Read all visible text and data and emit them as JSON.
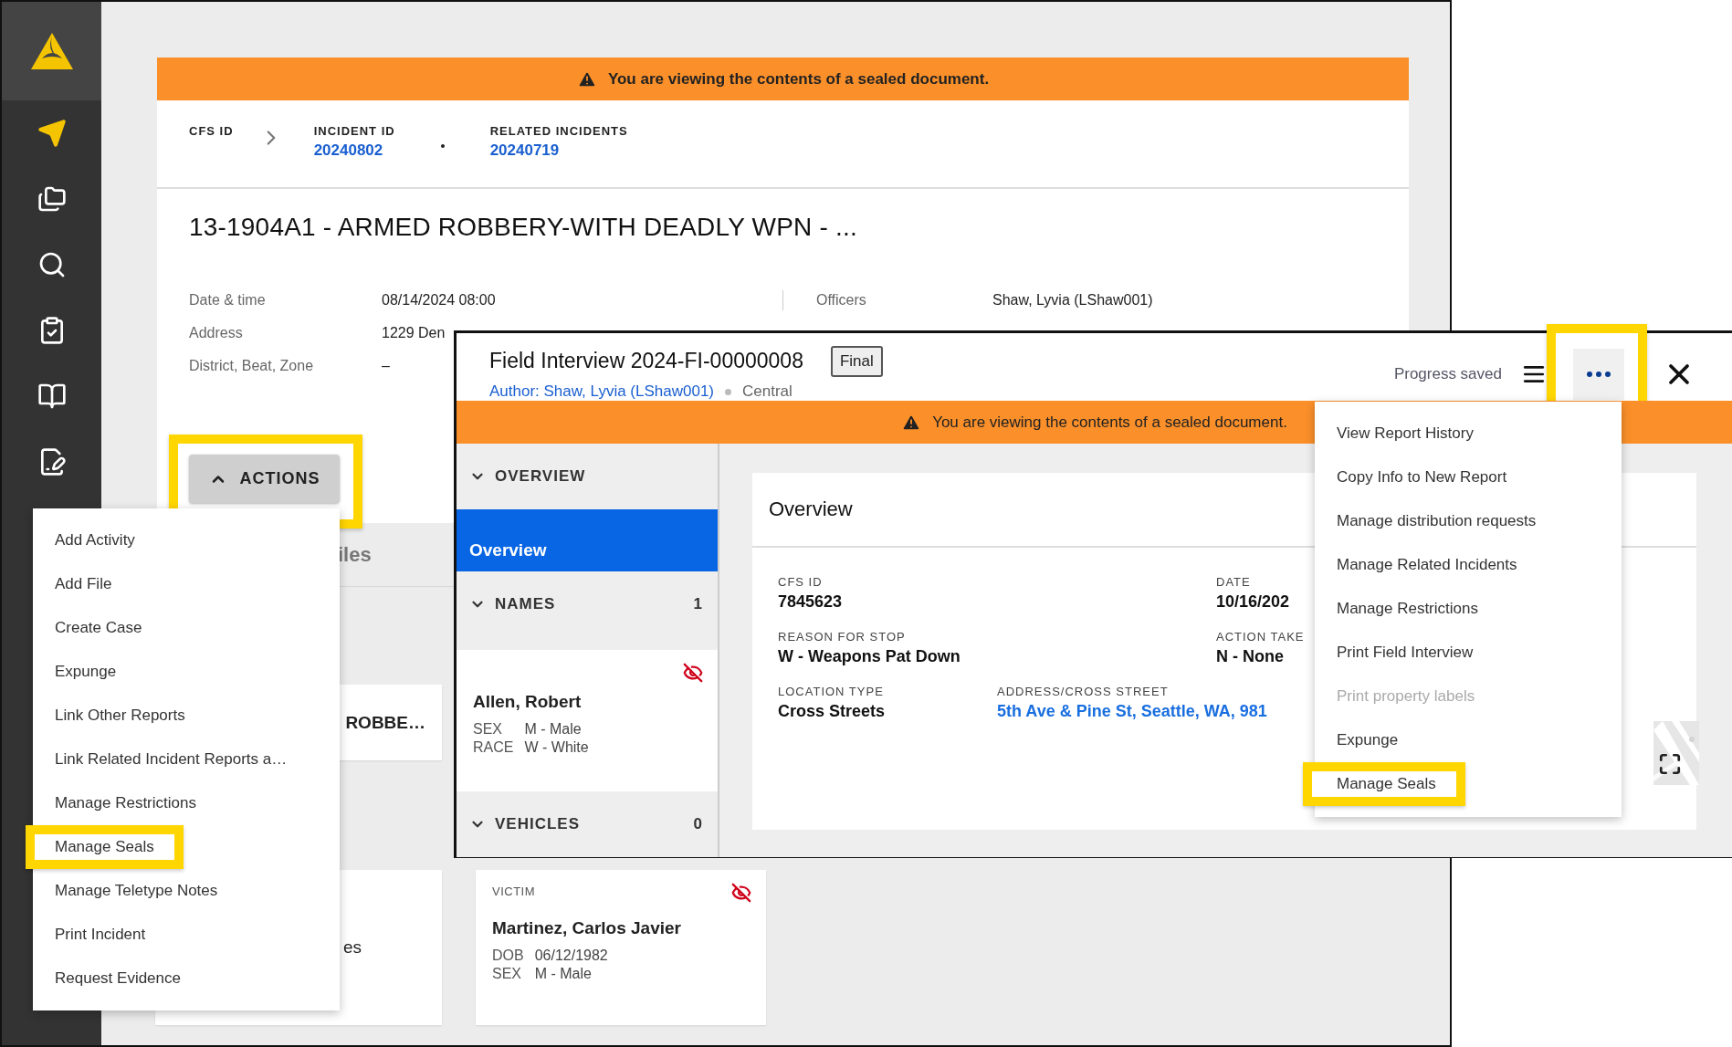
{
  "sidebar": {
    "items": [
      {
        "kind": "send",
        "selected": true
      },
      {
        "kind": "folders",
        "selected": false
      },
      {
        "kind": "search",
        "selected": false
      },
      {
        "kind": "clipboard",
        "selected": false
      },
      {
        "kind": "book",
        "selected": false
      },
      {
        "kind": "document",
        "selected": false
      }
    ]
  },
  "incident": {
    "banner": "You are viewing the contents of a sealed document.",
    "cfs_label": "CFS ID",
    "incident_id": {
      "label": "INCIDENT ID",
      "value": "20240802"
    },
    "related": {
      "label": "RELATED INCIDENTS",
      "value": "20240719"
    },
    "title": "13-1904A1 - ARMED ROBBERY-WITH DEADLY WPN - ...",
    "details": [
      {
        "label": "Date & time",
        "value": "08/14/2024 08:00"
      },
      {
        "label": "Address",
        "value": "1229 Den"
      },
      {
        "label": "District, Beat, Zone",
        "value": "–"
      }
    ],
    "officers": {
      "label": "Officers",
      "value": "Shaw, Lyvia (LShaw001)"
    },
    "actions_button": {
      "label": "ACTIONS",
      "highlighted": true
    },
    "tab_fragment": "iles",
    "card_fragments": [
      "ROBBE…",
      "es"
    ],
    "victim": {
      "role": "VICTIM",
      "name": "Martinez, Carlos Javier",
      "sealed": true,
      "fields": [
        {
          "label": "DOB",
          "value": "06/12/1982"
        },
        {
          "label": "SEX",
          "value": "M - Male"
        }
      ]
    }
  },
  "actions_menu": {
    "items": [
      {
        "label": "Add Activity",
        "highlighted": false
      },
      {
        "label": "Add File",
        "highlighted": false
      },
      {
        "label": "Create Case",
        "highlighted": false
      },
      {
        "label": "Expunge",
        "highlighted": false
      },
      {
        "label": "Link Other Reports",
        "highlighted": false
      },
      {
        "label": "Link Related Incident Reports a…",
        "highlighted": false
      },
      {
        "label": "Manage Restrictions",
        "highlighted": false
      },
      {
        "label": "Manage Seals",
        "highlighted": true
      },
      {
        "label": "Manage Teletype Notes",
        "highlighted": false
      },
      {
        "label": "Print Incident",
        "highlighted": false
      },
      {
        "label": "Request Evidence",
        "highlighted": false
      }
    ]
  },
  "field_interview": {
    "title": "Field Interview 2024-FI-00000008",
    "status": "Final",
    "author": "Author: Shaw, Lyvia (LShaw001)",
    "district": "Central",
    "progress": "Progress saved",
    "more_button": {
      "highlighted": true
    },
    "banner": "You are viewing the contents of a sealed document.",
    "nav": [
      {
        "kind": "section",
        "label": "OVERVIEW",
        "expanded": true
      },
      {
        "kind": "item",
        "label": "Overview",
        "selected": true
      },
      {
        "kind": "section",
        "label": "NAMES",
        "count": "1",
        "expanded": true
      },
      {
        "kind": "person",
        "name": "Allen, Robert",
        "sealed": true,
        "fields": [
          {
            "label": "SEX",
            "value": "M - Male"
          },
          {
            "label": "RACE",
            "value": "W - White"
          }
        ]
      },
      {
        "kind": "section",
        "label": "VEHICLES",
        "count": "0",
        "expanded": true
      }
    ],
    "overview": {
      "title": "Overview",
      "fields": [
        {
          "kind": "text",
          "label": "CFS ID",
          "value": "7845623"
        },
        {
          "kind": "text",
          "label": "DATE",
          "value": "10/16/202"
        },
        {
          "kind": "text",
          "label": "REASON FOR STOP",
          "value": "W - Weapons Pat Down"
        },
        {
          "kind": "text",
          "label": "ACTION TAKE",
          "value": "N - None"
        },
        {
          "kind": "text",
          "label": "LOCATION TYPE",
          "value": "Cross Streets"
        },
        {
          "kind": "link",
          "label": "ADDRESS/CROSS STREET",
          "value": "5th Ave & Pine St, Seattle, WA, 981"
        }
      ]
    },
    "menu": {
      "items": [
        {
          "label": "View Report History",
          "disabled": false,
          "highlighted": false
        },
        {
          "label": "Copy Info to New Report",
          "disabled": false,
          "highlighted": false
        },
        {
          "label": "Manage distribution requests",
          "disabled": false,
          "highlighted": false
        },
        {
          "label": "Manage Related Incidents",
          "disabled": false,
          "highlighted": false
        },
        {
          "label": "Manage Restrictions",
          "disabled": false,
          "highlighted": false
        },
        {
          "label": "Print Field Interview",
          "disabled": false,
          "highlighted": false
        },
        {
          "label": "Print property labels",
          "disabled": true,
          "highlighted": false
        },
        {
          "label": "Expunge",
          "disabled": false,
          "highlighted": false
        },
        {
          "label": "Manage Seals",
          "disabled": false,
          "highlighted": true
        }
      ]
    }
  }
}
